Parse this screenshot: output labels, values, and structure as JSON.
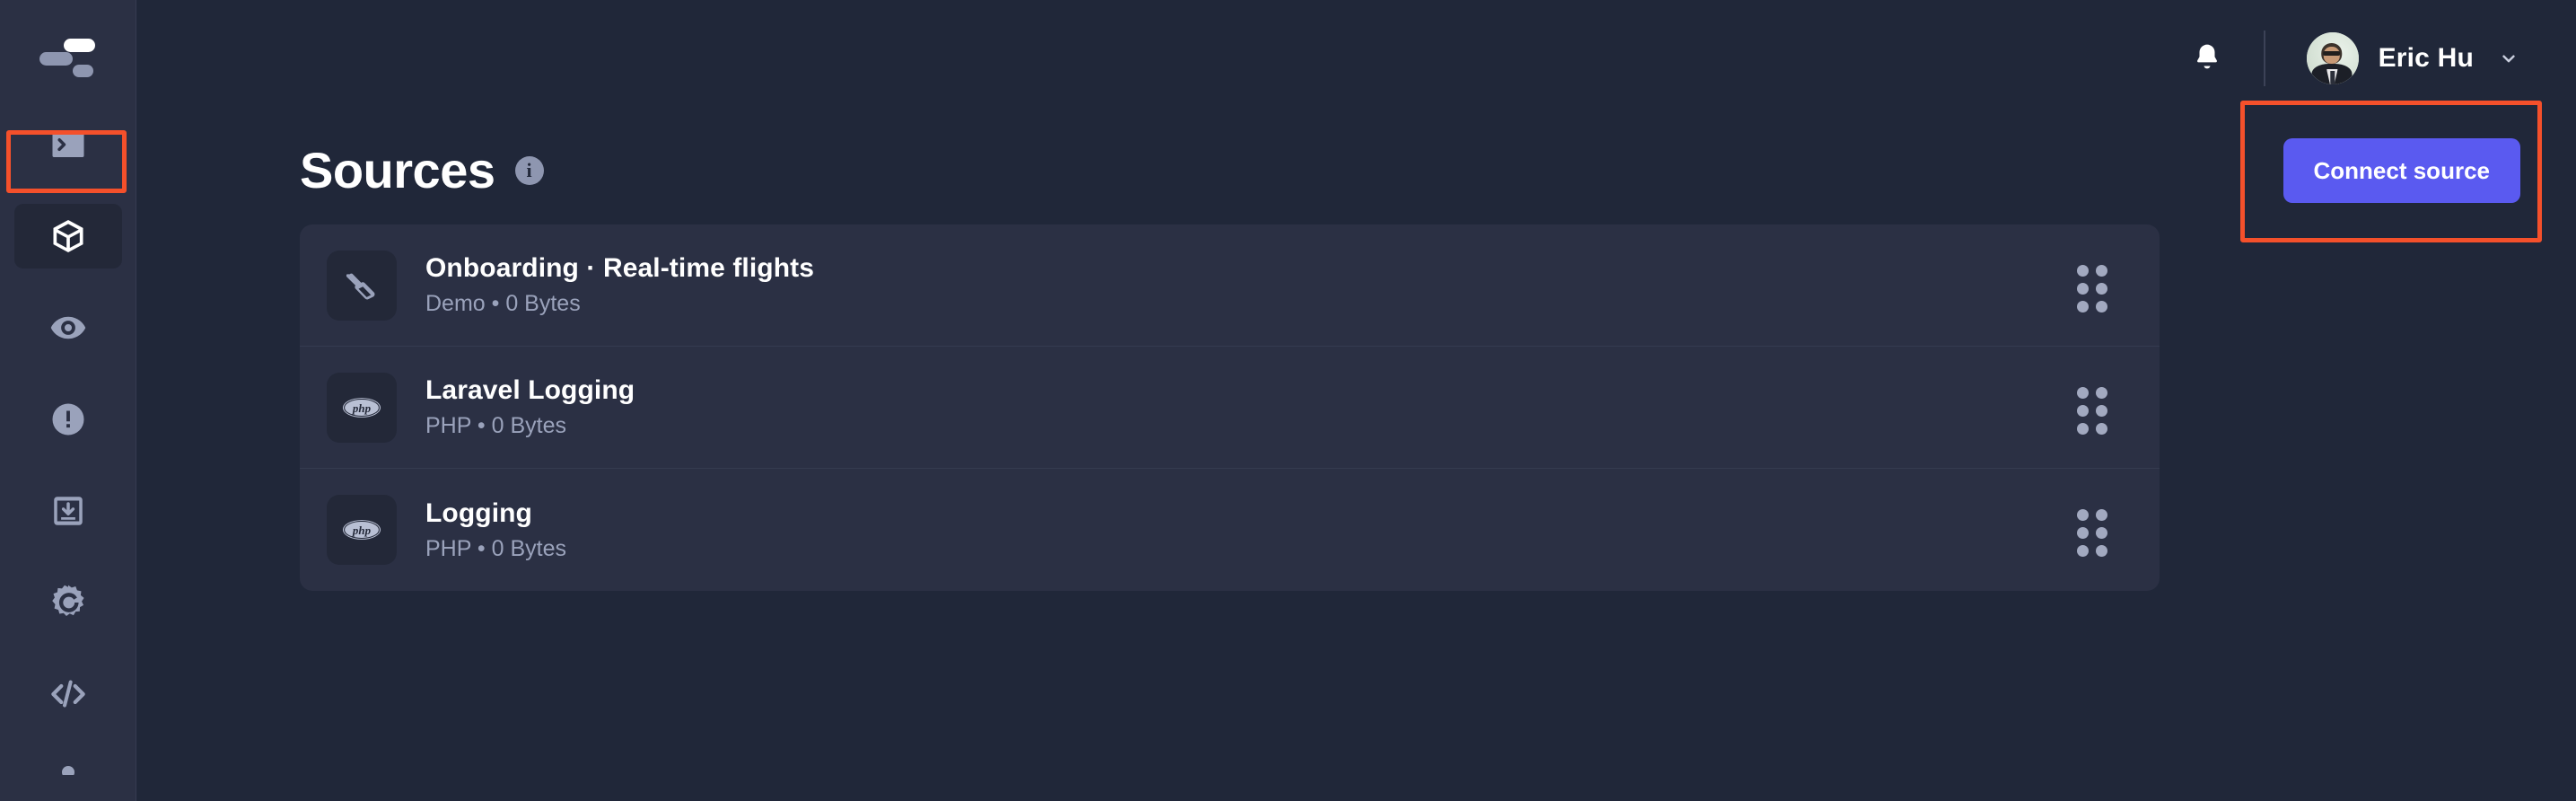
{
  "theme": {
    "bg": "#202739",
    "panel": "#2b3044",
    "tile": "#232838",
    "accent": "#5a5af0",
    "muted": "#9aa2bb",
    "highlight": "#f4502b",
    "divider": "#353b50"
  },
  "sidebar": {
    "logo_name": "logstack-logo",
    "items": [
      {
        "name": "sidebar-item-terminal",
        "icon": "terminal-icon",
        "label": "Terminal",
        "active": false
      },
      {
        "name": "sidebar-item-sources",
        "icon": "cube-icon",
        "label": "Sources",
        "active": true
      },
      {
        "name": "sidebar-item-live-tail",
        "icon": "eye-icon",
        "label": "Live tail",
        "active": false
      },
      {
        "name": "sidebar-item-alerts",
        "icon": "alert-icon",
        "label": "Alerts",
        "active": false
      },
      {
        "name": "sidebar-item-archive",
        "icon": "inbox-download-icon",
        "label": "Archive",
        "active": false
      },
      {
        "name": "sidebar-item-grafana",
        "icon": "grafana-icon",
        "label": "Grafana",
        "active": false
      },
      {
        "name": "sidebar-item-api",
        "icon": "code-brackets-icon",
        "label": "API",
        "active": false
      }
    ]
  },
  "header": {
    "notifications_icon": "bell-icon",
    "user": {
      "name": "Eric Hu",
      "avatar_name": "user-avatar",
      "chevron_icon": "chevron-down-icon"
    }
  },
  "page": {
    "title": "Sources",
    "info_icon": "info-icon",
    "info_glyph": "i",
    "primary_action": "Connect source"
  },
  "sources": [
    {
      "title": "Onboarding · Real-time flights",
      "subtitle": "Demo • 0 Bytes",
      "icon": "airplane-tail-icon",
      "drag_handle": "drag-handle-icon"
    },
    {
      "title": "Laravel Logging",
      "subtitle": "PHP • 0 Bytes",
      "icon": "php-icon",
      "drag_handle": "drag-handle-icon"
    },
    {
      "title": "Logging",
      "subtitle": "PHP • 0 Bytes",
      "icon": "php-icon",
      "drag_handle": "drag-handle-icon"
    }
  ],
  "annotations": [
    {
      "name": "highlight-sidebar-sources",
      "color": "#f4502b"
    },
    {
      "name": "highlight-connect-source",
      "color": "#f4502b"
    }
  ]
}
